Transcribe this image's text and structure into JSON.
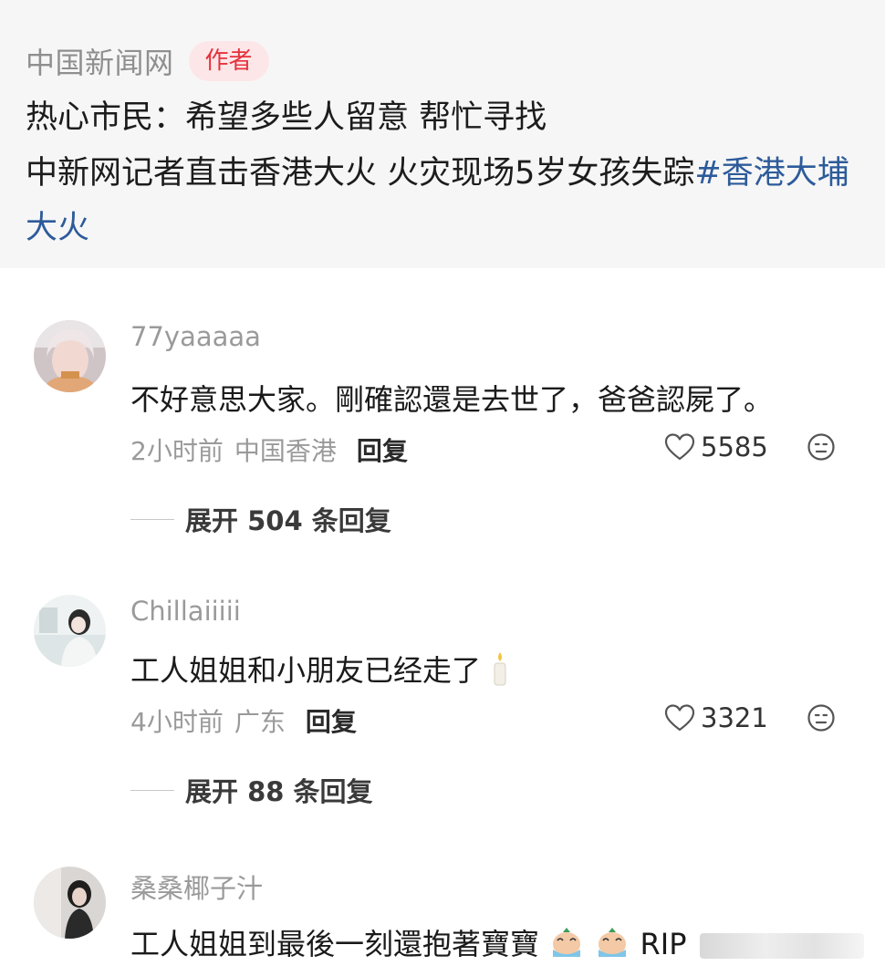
{
  "post": {
    "source": "中国新闻网",
    "badge": "作者",
    "quote": "热心市民：希望多些人留意 帮忙寻找",
    "body": "中新网记者直击香港大火 火灾现场5岁女孩失踪",
    "hashtag": "#香港大埔大火"
  },
  "comments": [
    {
      "username": "77yaaaaa",
      "text": "不好意思大家。剛確認還是去世了，爸爸認屍了。",
      "time": "2小时前",
      "location": "中国香港",
      "reply": "回复",
      "likes": "5585",
      "expand": "展开 504 条回复"
    },
    {
      "username": "Chillaiiiii",
      "text": "工人姐姐和小朋友已经走了",
      "time": "4小时前",
      "location": "广东",
      "reply": "回复",
      "likes": "3321",
      "expand": "展开 88 条回复"
    },
    {
      "username": "桑桑椰子汁",
      "text": "工人姐姐到最後一刻還抱著寶寶",
      "text_suffix": "RIP"
    }
  ],
  "icons": {
    "like": "heart-outline-icon",
    "dislike": "sad-face-icon",
    "candle": "candle-emoji",
    "crying": "crying-emoji"
  },
  "colors": {
    "badge_bg": "#fde6e8",
    "badge_text": "#e5323c",
    "hashtag": "#2d5b9a",
    "card_bg": "#f6f6f6"
  }
}
